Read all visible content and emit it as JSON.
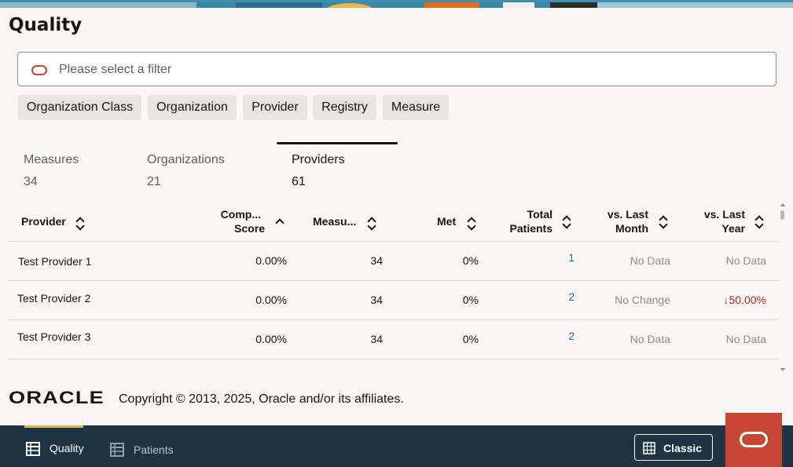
{
  "page": {
    "title": "Quality"
  },
  "filter": {
    "placeholder": "Please select a filter"
  },
  "chips": [
    "Organization Class",
    "Organization",
    "Provider",
    "Registry",
    "Measure"
  ],
  "metrics": [
    {
      "label": "Measures",
      "value": "34"
    },
    {
      "label": "Organizations",
      "value": "21"
    },
    {
      "label": "Providers",
      "value": "61",
      "active": true
    }
  ],
  "table": {
    "headers": [
      {
        "line1": "Provider",
        "line2": ""
      },
      {
        "line1": "Comp...",
        "line2": "Score"
      },
      {
        "line1": "Measu...",
        "line2": ""
      },
      {
        "line1": "Met",
        "line2": ""
      },
      {
        "line1": "Total",
        "line2": "Patients"
      },
      {
        "line1": "vs. Last",
        "line2": "Month"
      },
      {
        "line1": "vs. Last",
        "line2": "Year"
      }
    ],
    "rows": [
      {
        "provider": "Test Provider 1",
        "score": "0.00%",
        "measures": "34",
        "met": "0%",
        "patients": "1",
        "vs_month": "No Data",
        "vs_year": "No Data"
      },
      {
        "provider": "Test Provider 2",
        "score": "0.00%",
        "measures": "34",
        "met": "0%",
        "patients": "2",
        "vs_month": "No Change",
        "vs_year": "50.00%"
      },
      {
        "provider": "Test Provider 3",
        "score": "0.00%",
        "measures": "34",
        "met": "0%",
        "patients": "2",
        "vs_month": "No Data",
        "vs_year": "No Data"
      }
    ],
    "partial_row_patients": "-",
    "trend_down_arrow": "↓"
  },
  "footer": {
    "logo_text": "ORACLE",
    "copyright": "Copyright © 2013, 2025, Oracle and/or its affiliates."
  },
  "bottom_nav": {
    "items": [
      {
        "label": "Quality",
        "icon": "table-icon",
        "active": true
      },
      {
        "label": "Patients",
        "icon": "table-icon",
        "active": false
      }
    ],
    "classic_label": "Classic"
  },
  "colors": {
    "accent_red": "#c74634",
    "nav_bg": "#1e3445",
    "active_underline": "#e3b345",
    "link_blue": "#2c6ba0",
    "negative_red": "#b0281d"
  }
}
